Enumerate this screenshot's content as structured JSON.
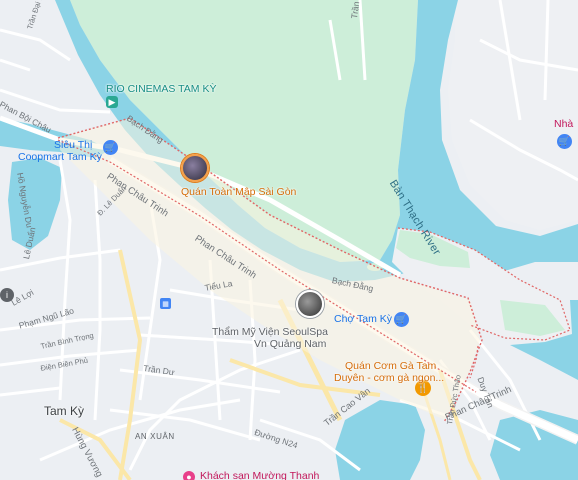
{
  "map": {
    "colors": {
      "land": "#eceff3",
      "water": "#8bd3e6",
      "park": "#cdeed9",
      "road": "#ffffff",
      "major_road": "#fbe7a8",
      "boundary": "#e06666"
    },
    "water_labels": {
      "river": "Bàn Thạch River"
    },
    "streets": {
      "phan_boi_chau": "Phan Bội Châu",
      "bach_dang_1": "Bạch Đằng",
      "bach_dang_2": "Bạch Đằng",
      "phan_chau_trinh_1": "Phan Châu Trinh",
      "phan_chau_trinh_2": "Phan Châu Trinh",
      "phan_chau_trinh_3": "Phan Châu Trinh",
      "tran_quy_cap": "Trần Quý Cáp",
      "ho_nguyen_du": "Hồ Nguyễn Du",
      "le_duan": "Lê Duẩn",
      "le_loi": "Lê Lợi",
      "pham_ngu_lao": "Phạm Ngũ Lão",
      "tran_binh_trong": "Trần Bình Trọng",
      "dien_bien_phu": "Điện Biên Phủ",
      "tieu_la": "Tiểu La",
      "tran_du": "Trần Dư",
      "tran_cao_van": "Trần Cao Vân",
      "duong_n24": "Đường N24",
      "hung_vuong": "Hùng Vương",
      "duy_tan": "Duy Tân",
      "tran_duc_thao": "Trần Đức Thảo",
      "d_le_duan": "Đ. Lê Duẩn",
      "tran_dai_nghia": "Trần Đại Nghĩa"
    },
    "places": {
      "rio_cinemas": "RIO CINEMAS TAM KỲ",
      "coopmart_line1": "Siêu Thị",
      "coopmart_line2": "Coopmart Tam Kỳ",
      "quan_toan": "Quán Toàn Mập Sài Gòn",
      "cho_tam_ky": "Chợ Tam Kỳ",
      "seoulspa_line1": "Thẩm Mỹ Viện SeoulSpa",
      "seoulspa_line2": "Vn Quảng Nam",
      "com_ga_line1": "Quán Cơm Gà Tam",
      "com_ga_line2": "Duyên - cơm gà ngon...",
      "nha": "Nhà",
      "khach_san": "Khách sạn Mường Thanh"
    },
    "areas": {
      "city": "Tam Kỳ",
      "district": "AN XUÂN"
    },
    "icons": [
      "cinema-icon",
      "shopping-cart-icon",
      "restaurant-icon",
      "bus-stop-icon",
      "info-pin-icon",
      "hotel-icon"
    ]
  }
}
